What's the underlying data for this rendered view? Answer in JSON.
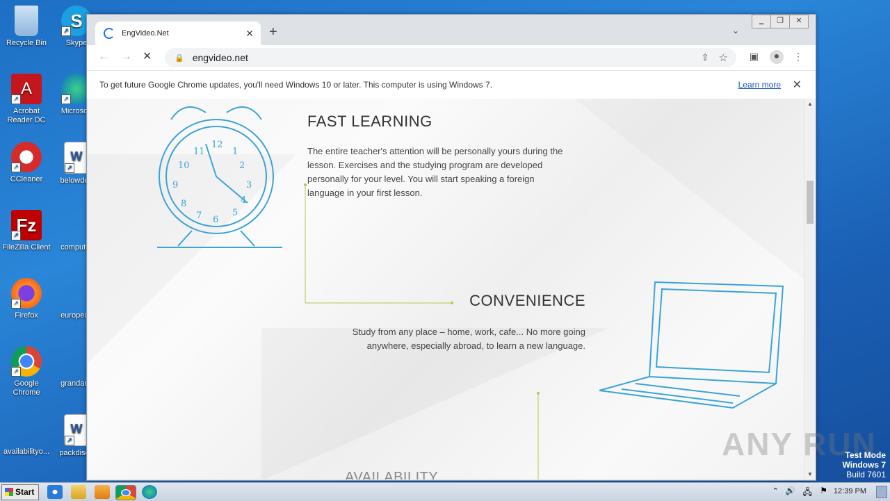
{
  "desktop": {
    "icons": [
      {
        "label": "Recycle Bin"
      },
      {
        "label": "Skype"
      },
      {
        "label": "Acrobat Reader DC"
      },
      {
        "label": "Microsoft"
      },
      {
        "label": "CCleaner"
      },
      {
        "label": "belowdea"
      },
      {
        "label": "FileZilla Client"
      },
      {
        "label": "computer"
      },
      {
        "label": "Firefox"
      },
      {
        "label": "europeac"
      },
      {
        "label": "Google Chrome"
      },
      {
        "label": "grandaus"
      },
      {
        "label": "availabilityo..."
      },
      {
        "label": "packdisea"
      }
    ],
    "watermark": {
      "line1": "Test Mode",
      "line2": "Windows 7",
      "line3": "Build 7601"
    },
    "anyrun_logo": "ANY RUN"
  },
  "browser": {
    "tab_title": "EngVideo.Net",
    "url": "engvideo.net",
    "infobar": {
      "message": "To get future Google Chrome updates, you'll need Windows 10 or later. This computer is using Windows 7.",
      "link": "Learn more"
    }
  },
  "page": {
    "sections": [
      {
        "heading": "FAST LEARNING",
        "text": "The entire teacher's attention will be personally yours during the lesson. Exercises and the studying program are developed personally for your level. You will start speaking a foreign language in your first lesson."
      },
      {
        "heading": "CONVENIENCE",
        "text": "Study from any place – home, work, cafe... No more going anywhere, especially abroad, to learn a new language."
      },
      {
        "heading": "AVAILABILITY"
      }
    ]
  },
  "taskbar": {
    "start_label": "Start",
    "time": "12:39 PM"
  }
}
